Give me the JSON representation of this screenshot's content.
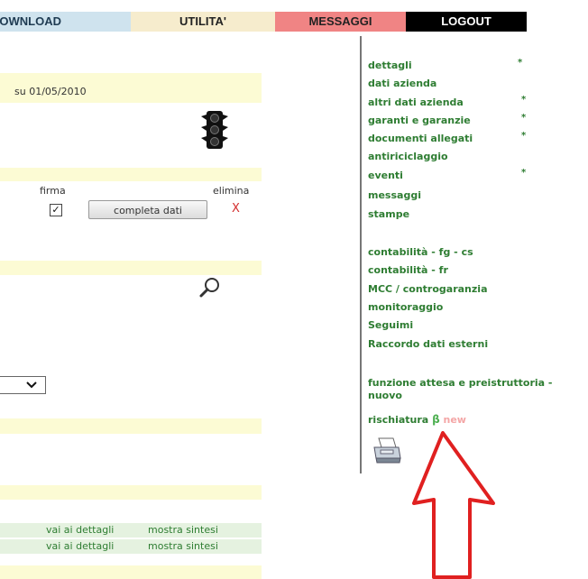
{
  "nav": {
    "download": "DOWNLOAD",
    "utilita": "UTILITA'",
    "messaggi": "MESSAGGI",
    "logout": "LOGOUT"
  },
  "content": {
    "date_text": "su 01/05/2010",
    "firma_label": "firma",
    "elimina_label": "elimina",
    "complete_button": "completa dati",
    "delete_symbol": "X",
    "checkbox_checked": true,
    "rows": [
      {
        "link1": "vai ai dettagli",
        "link2": "mostra sintesi"
      },
      {
        "link1": "vai ai dettagli",
        "link2": "mostra sintesi"
      }
    ]
  },
  "menu": {
    "items": [
      {
        "label": "dettagli",
        "star": "*"
      },
      {
        "label": "dati azienda",
        "star": ""
      },
      {
        "label": "altri dati azienda",
        "star": "*"
      },
      {
        "label": "garanti e garanzie",
        "star": "*"
      },
      {
        "label": "documenti allegati",
        "star": "*"
      },
      {
        "label": "antiriciclaggio",
        "star": ""
      },
      {
        "label": "eventi",
        "star": "*"
      },
      {
        "label": "messaggi",
        "star": ""
      },
      {
        "label": "stampe",
        "star": ""
      },
      {
        "label": "contabilità - fg - cs",
        "star": ""
      },
      {
        "label": "contabilità - fr",
        "star": ""
      },
      {
        "label": "MCC / controgaranzia",
        "star": ""
      },
      {
        "label": "monitoraggio",
        "star": ""
      },
      {
        "label": "Seguimi",
        "star": ""
      },
      {
        "label": "Raccordo dati esterni",
        "star": ""
      },
      {
        "label": "funzione attesa e preistruttoria -",
        "star": ""
      },
      {
        "label": "nuovo",
        "star": ""
      }
    ],
    "rischiatura": "rischiatura",
    "beta": "β",
    "new": "new"
  },
  "icons": [
    "traffic-light-icon",
    "magnifier-icon",
    "printer-icon",
    "checkbox-icon",
    "chevron-down-icon",
    "arrow-up-annotation-icon"
  ],
  "colors": {
    "menu_green": "#2e7d32",
    "nav_download_bg": "#cfe3ee",
    "nav_utilita_bg": "#f6eccd",
    "nav_messaggi_bg": "#f08484",
    "nav_logout_bg": "#000000",
    "annotation_red": "#e02020"
  }
}
